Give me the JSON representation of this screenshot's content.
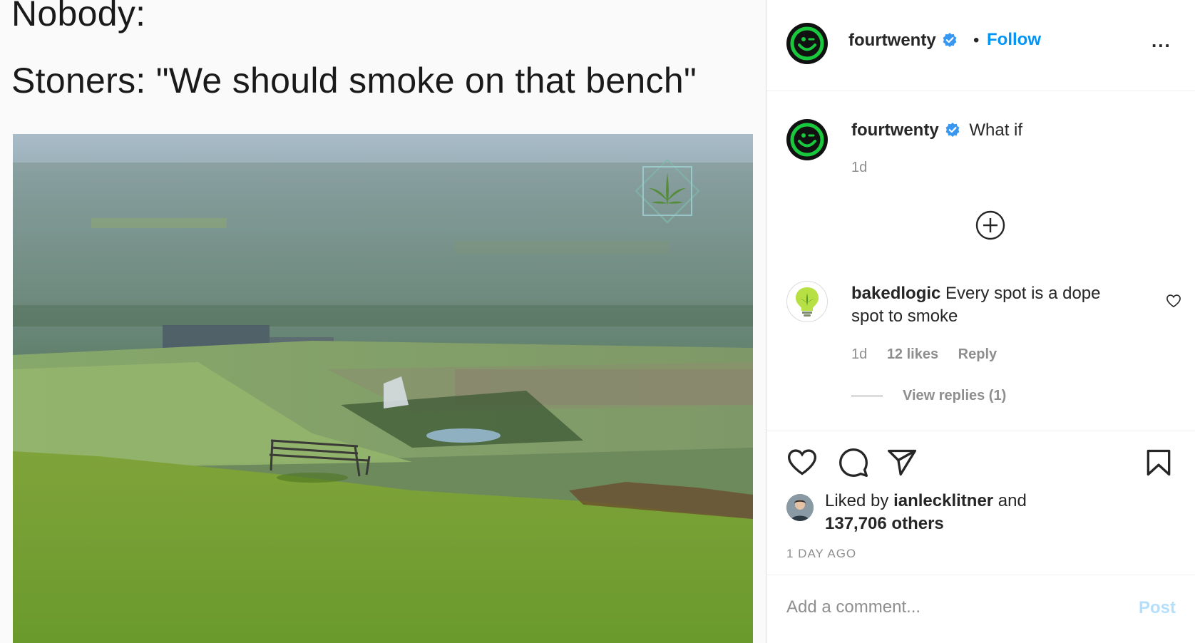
{
  "post": {
    "meme_line1": "Nobody:",
    "meme_line2": "Stoners: \"We should smoke on that bench\""
  },
  "header": {
    "username": "fourtwenty",
    "separator": "•",
    "follow_label": "Follow",
    "more_label": "..."
  },
  "caption": {
    "username": "fourtwenty",
    "text": "What if",
    "time": "1d"
  },
  "comments": [
    {
      "username": "bakedlogic",
      "text": "Every spot is a dope spot to smoke",
      "time": "1d",
      "likes": "12 likes",
      "reply_label": "Reply",
      "view_replies": "View replies (1)"
    }
  ],
  "likes": {
    "prefix": "Liked by",
    "user": "ianlecklitner",
    "joiner": "and",
    "others": "137,706 others"
  },
  "timestamp": "1 DAY AGO",
  "add_comment": {
    "placeholder": "Add a comment...",
    "post_label": "Post"
  },
  "colors": {
    "accent": "#0095f6",
    "post_disabled": "#b2dffc",
    "verified": "#3897f0",
    "avatar_green": "#19c83c"
  },
  "icons": [
    "verified-badge-icon",
    "more-options-icon",
    "load-more-comments-icon",
    "heart-icon",
    "comment-icon",
    "share-icon",
    "bookmark-icon",
    "comment-like-heart-icon"
  ]
}
